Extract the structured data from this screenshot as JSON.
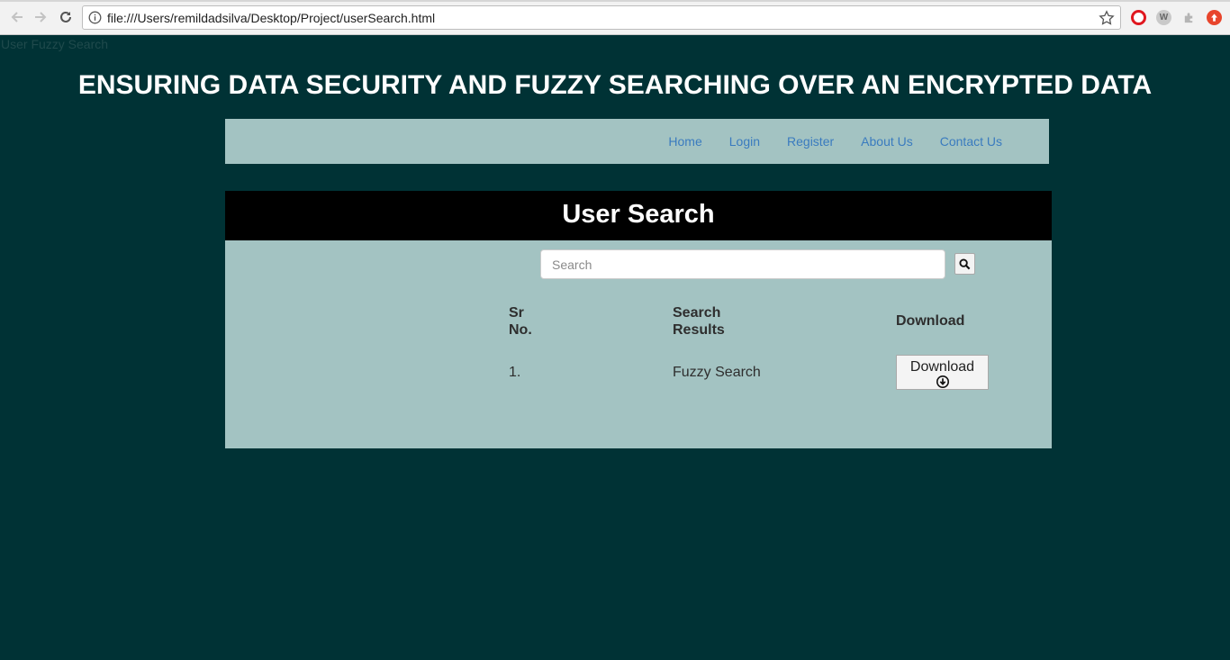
{
  "browser": {
    "url": "file:///Users/remildadsilva/Desktop/Project/userSearch.html",
    "extensions": [
      "opera-icon",
      "w-extension-icon",
      "puzzle-extension-icon",
      "upload-extension-icon"
    ],
    "ext_w_label": "W"
  },
  "page": {
    "document_title": "User Fuzzy Search",
    "heading": "ENSURING DATA SECURITY AND FUZZY SEARCHING OVER AN ENCRYPTED DATA"
  },
  "nav": {
    "home": "Home",
    "login": "Login",
    "register": "Register",
    "about": "About Us",
    "contact": "Contact Us"
  },
  "panel": {
    "title": "User Search",
    "search_placeholder": "Search",
    "table": {
      "headers": [
        "Sr No.",
        "Search Results",
        "Download"
      ],
      "rows": [
        {
          "sr": "1.",
          "result": "Fuzzy Search",
          "action": "Download"
        }
      ]
    }
  },
  "colors": {
    "page_bg": "#003235",
    "panel_bg": "#a3c3c2",
    "header_bg": "#000000",
    "link": "#3a7bbf"
  }
}
